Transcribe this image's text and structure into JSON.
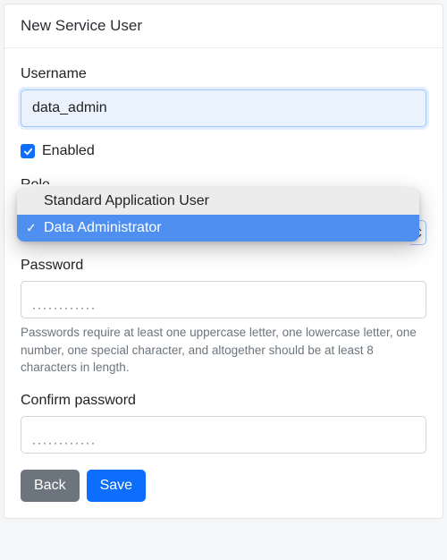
{
  "header": {
    "title": "New Service User"
  },
  "form": {
    "username": {
      "label": "Username",
      "value": "data_admin"
    },
    "enabled": {
      "label": "Enabled",
      "checked": true
    },
    "role": {
      "label": "Role",
      "options": [
        {
          "label": "Standard Application User",
          "selected": false
        },
        {
          "label": "Data Administrator",
          "selected": true
        }
      ]
    },
    "password": {
      "label": "Password",
      "mask": "············",
      "help": "Passwords require at least one uppercase letter, one lowercase letter, one number, one special character, and altogether should be at least 8 characters in length."
    },
    "confirm": {
      "label": "Confirm password",
      "mask": "············"
    }
  },
  "actions": {
    "back": "Back",
    "save": "Save"
  }
}
